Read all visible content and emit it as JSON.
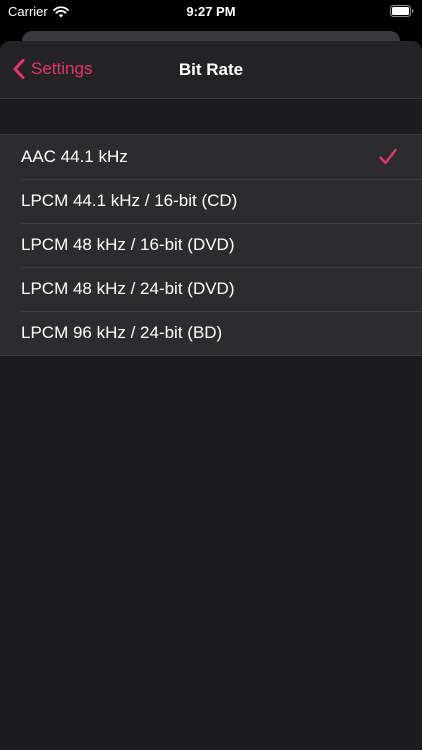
{
  "status_bar": {
    "carrier": "Carrier",
    "time": "9:27 PM",
    "icons": [
      "wifi-icon",
      "battery-icon"
    ]
  },
  "nav": {
    "back_label": "Settings",
    "back_icon": "chevron-left-icon",
    "title": "Bit Rate"
  },
  "options": [
    {
      "label": "AAC 44.1 kHz",
      "selected": true
    },
    {
      "label": "LPCM 44.1 kHz / 16-bit (CD)",
      "selected": false
    },
    {
      "label": "LPCM 48 kHz / 16-bit (DVD)",
      "selected": false
    },
    {
      "label": "LPCM 48 kHz / 24-bit (DVD)",
      "selected": false
    },
    {
      "label": "LPCM 96 kHz / 24-bit (BD)",
      "selected": false
    }
  ],
  "colors": {
    "accent": "#e8336d",
    "background": "#1c1c1e",
    "row_background": "#2c2c2e",
    "text": "#ffffff"
  }
}
